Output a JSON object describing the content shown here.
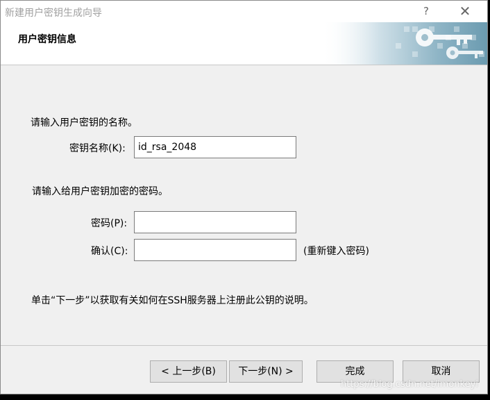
{
  "window": {
    "title": "新建用户密钥生成向导",
    "help_glyph": "?",
    "close_glyph": "✕"
  },
  "header": {
    "title": "用户密钥信息",
    "banner_icon": "key-icon"
  },
  "form": {
    "name_prompt": "请输入用户密钥的名称。",
    "name_label": "密钥名称(K):",
    "name_value": "id_rsa_2048",
    "password_prompt": "请输入给用户密钥加密的密码。",
    "password_label": "密码(P):",
    "password_value": "",
    "confirm_label": "确认(C):",
    "confirm_value": "",
    "confirm_hint": "(重新键入密码)",
    "instruction": "单击“下一步”以获取有关如何在SSH服务器上注册此公钥的说明。"
  },
  "buttons": {
    "back": "< 上一步(B)",
    "next": "下一步(N) >",
    "finish": "完成",
    "cancel": "取消"
  },
  "watermark": "https://blog.csdn.net/imonkeyi",
  "colors": {
    "window_bg": "#f0f0f0",
    "header_bg": "#ffffff",
    "banner_teal": "#7aa6b8"
  }
}
